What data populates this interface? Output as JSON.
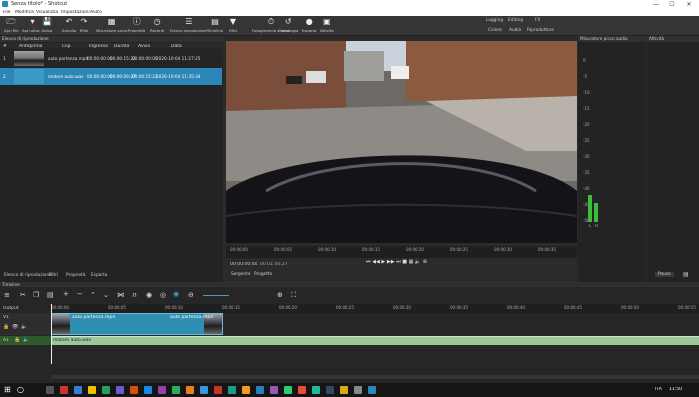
{
  "window": {
    "title": "Senza titolo* - Shotcut",
    "min": "—",
    "max": "☐",
    "close": "✕"
  },
  "menu": [
    "File",
    "Modifica",
    "Visualizza",
    "Impostazioni",
    "Aiuto"
  ],
  "toolbar": [
    {
      "label": "Apri file",
      "icon": "open-file-icon",
      "glyph": "🗁"
    },
    {
      "label": "Apri altro...",
      "icon": "open-other-icon",
      "glyph": "▾"
    },
    {
      "label": "Salva",
      "icon": "save-icon",
      "glyph": "💾"
    },
    {
      "label": "Annulla",
      "icon": "undo-icon",
      "glyph": "↶"
    },
    {
      "label": "Rifai",
      "icon": "redo-icon",
      "glyph": "↷"
    },
    {
      "label": "Misuratore picco",
      "icon": "peak-meter-icon",
      "glyph": "▦"
    },
    {
      "label": "Proprietà",
      "icon": "properties-icon",
      "glyph": "ⓘ"
    },
    {
      "label": "Recenti",
      "icon": "recent-icon",
      "glyph": "◷"
    },
    {
      "label": "Elenco riproduzione",
      "icon": "playlist-icon",
      "glyph": "☰"
    },
    {
      "label": "Timeline",
      "icon": "timeline-icon",
      "glyph": "▤"
    },
    {
      "label": "Filtri",
      "icon": "filter-icon",
      "glyph": "▼"
    },
    {
      "label": "Fotogramma chiave",
      "icon": "keyframe-icon",
      "glyph": "⏱"
    },
    {
      "label": "Cronologia",
      "icon": "history-icon",
      "glyph": "↺"
    },
    {
      "label": "Esporta",
      "icon": "export-icon",
      "glyph": "●"
    },
    {
      "label": "Attività",
      "icon": "jobs-icon",
      "glyph": "▣"
    }
  ],
  "workspaces": {
    "row1": [
      "Logging",
      "Editing",
      "FX"
    ],
    "row2": [
      "Colore",
      "Audio",
      "Riproduttore"
    ]
  },
  "playlist": {
    "title": "Elenco di riproduzione",
    "columns": [
      "#",
      "Anteprima",
      "Clip",
      "Ingresso",
      "Durata",
      "Avvio",
      "Data"
    ],
    "rows": [
      {
        "num": "1",
        "clip": "auto partenza.mp4",
        "in": "00:00:00:00",
        "dur": "00:00:15:22",
        "start": "00:00:00:00",
        "date": "2020-10-04 11:27:25"
      },
      {
        "num": "2",
        "clip": "motore auto.wav",
        "in": "00:00:00:00",
        "dur": "00:00:09:27",
        "start": "00:00:15:22",
        "date": "2020-10-04 11:35:34"
      }
    ],
    "tabs": [
      "Elenco di riproduzione",
      "Filtri",
      "Proprietà",
      "Esporta"
    ]
  },
  "player": {
    "ruler": [
      "00:00:00",
      "00:00:05",
      "00:00:10",
      "00:00:15",
      "00:00:20",
      "00:00:25",
      "00:00:30",
      "00:00:35"
    ],
    "position": "00:00:00:00",
    "duration": "00:01:00:27",
    "tabs": [
      "Sorgente",
      "Progetto"
    ]
  },
  "meter": {
    "title": "Misuratore picco audio",
    "labels": [
      "0",
      "-5",
      "-10",
      "-15",
      "-20",
      "-25",
      "-30",
      "-35",
      "-40",
      "-45",
      "-50"
    ],
    "channels": [
      "L",
      "R"
    ],
    "levels": [
      0.42,
      0.3
    ]
  },
  "activity": {
    "title": "Attività",
    "pause": "Pausa"
  },
  "timeline": {
    "title": "Timeline",
    "output": "Output",
    "ruler": [
      "00:00:00",
      "00:00:05",
      "00:00:10",
      "00:00:15",
      "00:00:20",
      "00:00:25",
      "00:00:30",
      "00:00:35",
      "00:00:40",
      "00:00:45",
      "00:00:50",
      "00:00:55"
    ],
    "v1": {
      "name": "V1",
      "clips": [
        "auto partenza.mp4",
        "auto partenza.mp4"
      ]
    },
    "a1": {
      "name": "A1",
      "clip": "motore auto.wav"
    }
  },
  "taskbar": {
    "time": "11:50",
    "lang": "ITA"
  },
  "colors": {
    "accent": "#2c87b8",
    "video_clip": "#2f8fb0",
    "audio_clip": "#9bc79b"
  }
}
